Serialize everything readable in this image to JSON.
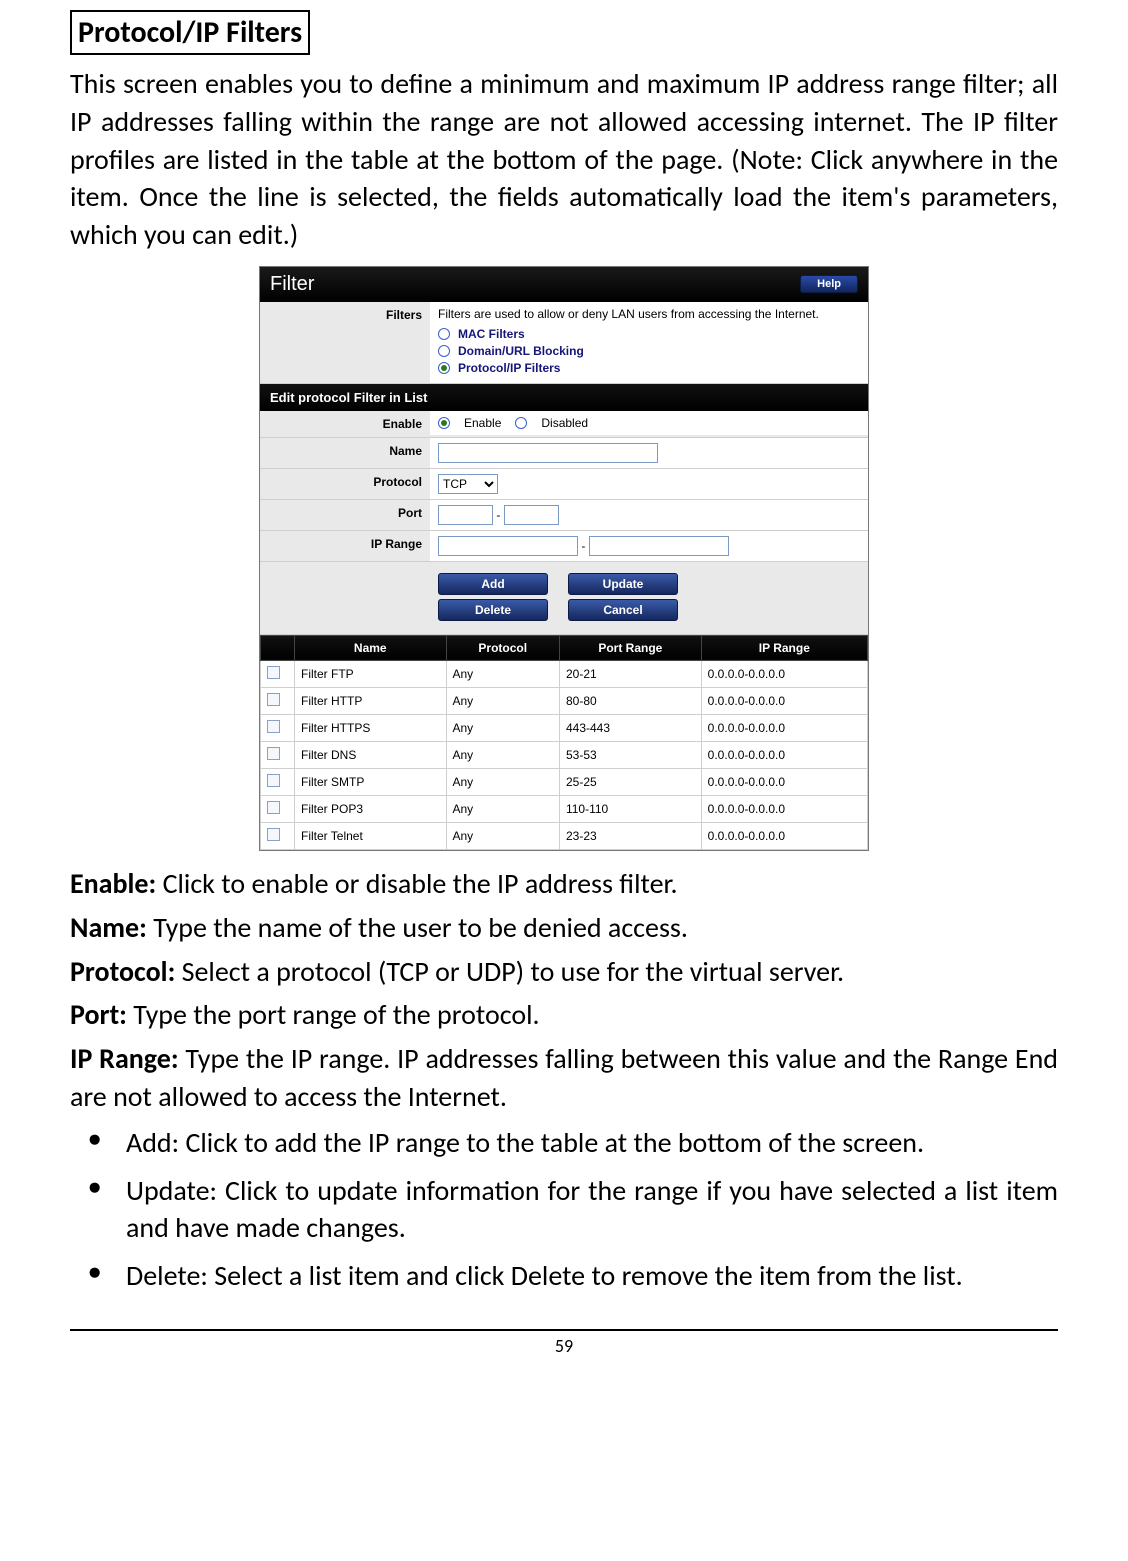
{
  "title": "Protocol/IP Filters",
  "intro": "This screen enables you to define a minimum and maximum IP address range filter; all IP addresses falling within the range are not allowed accessing internet. The IP filter profiles are listed in the table at the bottom of the page. (Note: Click anywhere in the item. Once the line is selected, the fields automatically load the item's parameters, which you can edit.)",
  "ui": {
    "header": "Filter",
    "help": "Help",
    "filters_label": "Filters",
    "filters_desc": "Filters are used to allow or deny LAN users from accessing the Internet.",
    "radio_mac": "MAC Filters",
    "radio_domain": "Domain/URL Blocking",
    "radio_protocol": "Protocol/IP Filters",
    "edit_header": "Edit protocol Filter in List",
    "enable_label": "Enable",
    "enable_opt1": "Enable",
    "enable_opt2": "Disabled",
    "name_label": "Name",
    "protocol_label": "Protocol",
    "protocol_value": "TCP",
    "port_label": "Port",
    "dash": "-",
    "iprange_label": "IP Range",
    "btn_add": "Add",
    "btn_update": "Update",
    "btn_delete": "Delete",
    "btn_cancel": "Cancel",
    "cols": {
      "name": "Name",
      "protocol": "Protocol",
      "port": "Port Range",
      "ip": "IP Range"
    },
    "rows": [
      {
        "name": "Filter FTP",
        "protocol": "Any",
        "port": "20-21",
        "ip": "0.0.0.0-0.0.0.0"
      },
      {
        "name": "Filter HTTP",
        "protocol": "Any",
        "port": "80-80",
        "ip": "0.0.0.0-0.0.0.0"
      },
      {
        "name": "Filter HTTPS",
        "protocol": "Any",
        "port": "443-443",
        "ip": "0.0.0.0-0.0.0.0"
      },
      {
        "name": "Filter DNS",
        "protocol": "Any",
        "port": "53-53",
        "ip": "0.0.0.0-0.0.0.0"
      },
      {
        "name": "Filter SMTP",
        "protocol": "Any",
        "port": "25-25",
        "ip": "0.0.0.0-0.0.0.0"
      },
      {
        "name": "Filter POP3",
        "protocol": "Any",
        "port": "110-110",
        "ip": "0.0.0.0-0.0.0.0"
      },
      {
        "name": "Filter Telnet",
        "protocol": "Any",
        "port": "23-23",
        "ip": "0.0.0.0-0.0.0.0"
      }
    ]
  },
  "defs": {
    "enable_t": "Enable:",
    "enable_d": " Click to enable or disable the IP address filter.",
    "name_t": "Name:",
    "name_d": " Type the name of the user to be denied access.",
    "protocol_t": "Protocol:",
    "protocol_d": " Select a protocol (TCP or UDP) to use for the virtual server.",
    "port_t": "Port:",
    "port_d": " Type the port range of the protocol.",
    "iprange_t": "IP Range:",
    "iprange_d": " Type the IP range. IP addresses falling between this value and the Range End are not allowed to access the Internet."
  },
  "bullets": {
    "add_t": "Add:",
    "add_d": " Click to add the IP range to the table at the bottom of the screen.",
    "update_t": "Update:",
    "update_d": " Click to update information for the range if you have selected a list item and have made changes.",
    "delete_t": "Delete:",
    "delete_d": " Select a list item and click Delete to remove the item from the list."
  },
  "page_number": "59"
}
